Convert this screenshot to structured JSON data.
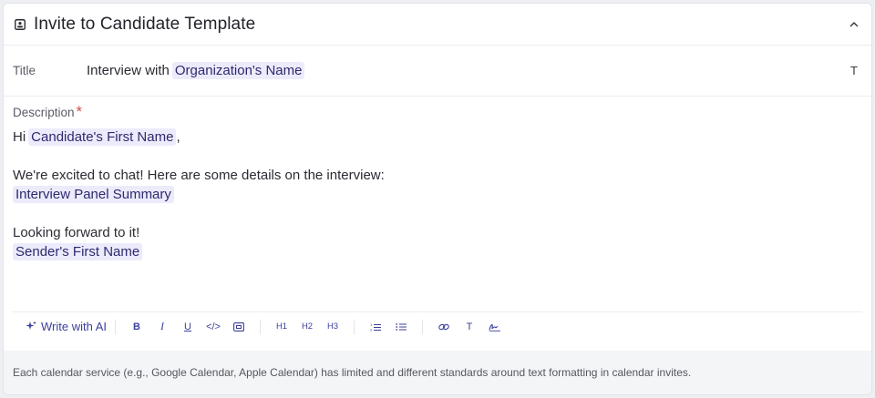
{
  "header": {
    "title": "Invite to Candidate Template",
    "template_icon": "template-card-icon",
    "collapse_icon": "chevron-up-icon"
  },
  "title_field": {
    "label": "Title",
    "text": "Interview with",
    "variable": "Organization's Name",
    "format_icon_text": "T"
  },
  "description": {
    "label": "Description",
    "required_mark": "*",
    "greeting": "Hi",
    "candidate_var": "Candidate's First Name",
    "greeting_suffix": ",",
    "line2": "We're excited to chat! Here are some details on the interview:",
    "panel_var": "Interview Panel Summary",
    "line3": "Looking forward to it!",
    "sender_var": "Sender's First Name"
  },
  "toolbar": {
    "ai_label": "Write with AI",
    "bold": "B",
    "italic": "I",
    "underline": "U",
    "code": "</>",
    "h1": "H1",
    "h2": "H2",
    "h3": "H3",
    "text": "T"
  },
  "footer": {
    "note": "Each calendar service (e.g., Google Calendar, Apple Calendar) has limited and different standards around text formatting in calendar invites."
  },
  "colors": {
    "accent": "#3b3f9a",
    "chip_bg": "#ecebfb",
    "required": "#d94a4a"
  }
}
